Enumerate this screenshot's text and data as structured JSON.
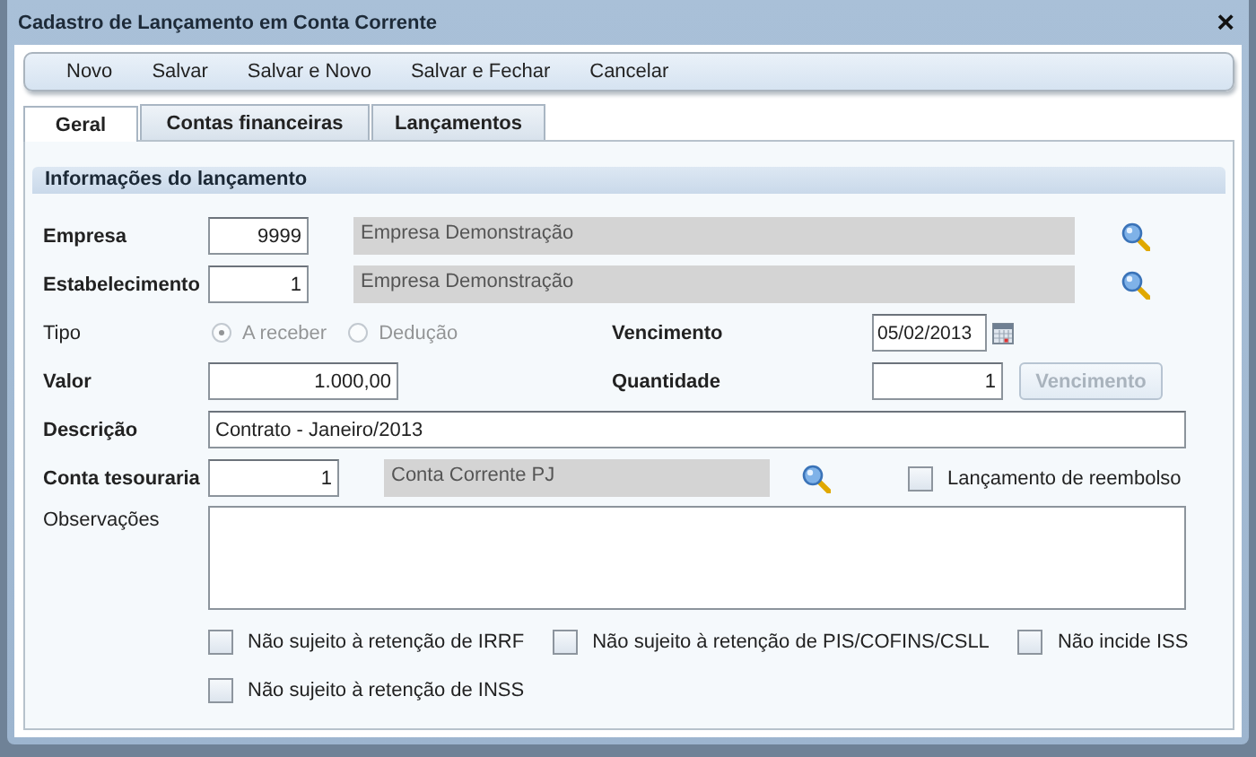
{
  "window": {
    "title": "Cadastro de Lançamento em Conta Corrente",
    "close": "×"
  },
  "toolbar": {
    "buttons": [
      "Novo",
      "Salvar",
      "Salvar e Novo",
      "Salvar e Fechar",
      "Cancelar"
    ]
  },
  "tabs": [
    {
      "label": "Geral",
      "selected": true
    },
    {
      "label": "Contas financeiras",
      "selected": false
    },
    {
      "label": "Lançamentos",
      "selected": false
    }
  ],
  "section": {
    "title": "Informações do lançamento"
  },
  "empresa": {
    "label": "Empresa",
    "bold": true,
    "code": "9999",
    "name": "Empresa Demonstração"
  },
  "estabelecimento": {
    "label": "Estabelecimento",
    "bold": true,
    "code": "1",
    "name": "Empresa Demonstração"
  },
  "tipo": {
    "label": "Tipo",
    "bold": false,
    "disabled": true,
    "options": [
      {
        "label": "A receber",
        "selected": true
      },
      {
        "label": "Dedução",
        "selected": false
      }
    ]
  },
  "vencimento": {
    "label": "Vencimento",
    "bold": true,
    "value": "05/02/2013"
  },
  "valor": {
    "label": "Valor",
    "bold": true,
    "value": "1.000,00"
  },
  "quantidade": {
    "label": "Quantidade",
    "bold": true,
    "value": "1"
  },
  "vencimento_button": {
    "label": "Vencimento",
    "disabled": true
  },
  "descricao": {
    "label": "Descrição",
    "bold": true,
    "value": "Contrato - Janeiro/2013"
  },
  "conta_tesouraria": {
    "label": "Conta tesouraria",
    "bold": true,
    "code": "1",
    "name": "Conta Corrente PJ"
  },
  "reembolso": {
    "label": "Lançamento de reembolso",
    "checked": false
  },
  "observacoes": {
    "label": "Observações",
    "bold": false
  },
  "retention_checks": [
    [
      {
        "label": "Não sujeito à retenção de IRRF",
        "checked": false
      },
      {
        "label": "Não sujeito à retenção de PIS/COFINS/CSLL",
        "checked": false
      },
      {
        "label": "Não incide ISS",
        "checked": false
      }
    ],
    [
      {
        "label": "Não sujeito à retenção de INSS",
        "checked": false
      }
    ]
  ]
}
